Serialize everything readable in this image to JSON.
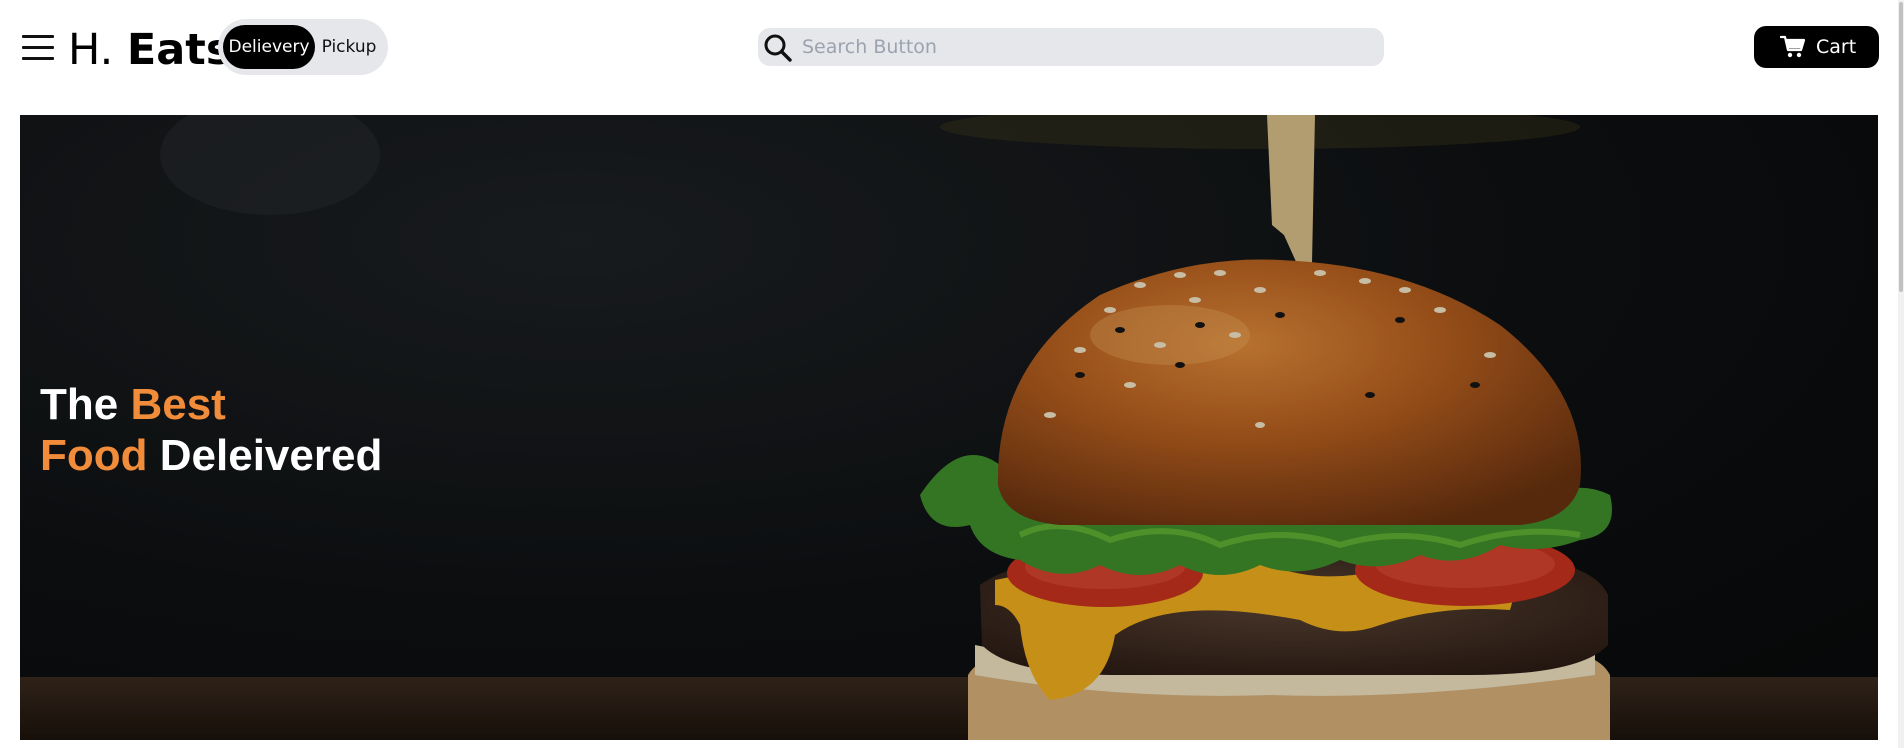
{
  "header": {
    "logo_prefix": "H.",
    "logo_name": "Eats",
    "menu_icon": "hamburger-menu-icon",
    "toggle": {
      "delivery_label": "Delievery",
      "pickup_label": "Pickup",
      "selected": "Delievery"
    },
    "search": {
      "placeholder": "Search Button",
      "value": "",
      "icon": "search-icon"
    },
    "cart": {
      "label": "Cart",
      "icon": "cart-icon"
    }
  },
  "hero": {
    "line1_a": "The",
    "line1_b": "Best",
    "line2_a": "Food",
    "line2_b": "Deleivered",
    "image_subject": "burger-photo"
  },
  "colors": {
    "accent": "#f08c3a",
    "toggle_active_bg": "#000000",
    "search_bg": "#e5e7eb",
    "cart_bg": "#000000",
    "hero_bg": "#0e1012"
  }
}
